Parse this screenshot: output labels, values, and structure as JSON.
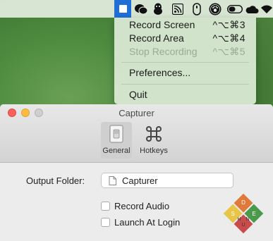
{
  "menubar": {
    "icons": [
      "capturer-icon",
      "wechat-icon",
      "qq-penguin-icon",
      "rss-icon",
      "mouse-icon",
      "paw-badge-icon",
      "toggle-icon",
      "cloud-icon",
      "wifi-icon"
    ],
    "accent": "#1f6fd6"
  },
  "menu": {
    "items": [
      {
        "label": "Record Screen",
        "shortcut": "^⌥⌘3",
        "enabled": true
      },
      {
        "label": "Record Area",
        "shortcut": "^⌥⌘4",
        "enabled": true
      },
      {
        "label": "Stop Recording",
        "shortcut": "^⌥⌘5",
        "enabled": false
      },
      {
        "label": "Preferences...",
        "shortcut": "",
        "enabled": true
      },
      {
        "label": "Quit",
        "shortcut": "",
        "enabled": true
      }
    ]
  },
  "window": {
    "title": "Capturer",
    "tabs": [
      {
        "label": "General",
        "icon": "switch-icon",
        "selected": true
      },
      {
        "label": "Hotkeys",
        "icon": "command-icon",
        "selected": false
      }
    ]
  },
  "general": {
    "output_folder_label": "Output Folder:",
    "output_folder_value": "Capturer",
    "record_audio_label": "Record Audio",
    "record_audio_checked": false,
    "launch_at_login_label": "Launch At Login",
    "launch_at_login_checked": false
  },
  "logo": {
    "letters": [
      "D",
      "S",
      "E",
      "H",
      "U",
      "N"
    ],
    "colors": [
      "#e07a3a",
      "#4b9a4b",
      "#c94b4b",
      "#e8c547"
    ]
  }
}
